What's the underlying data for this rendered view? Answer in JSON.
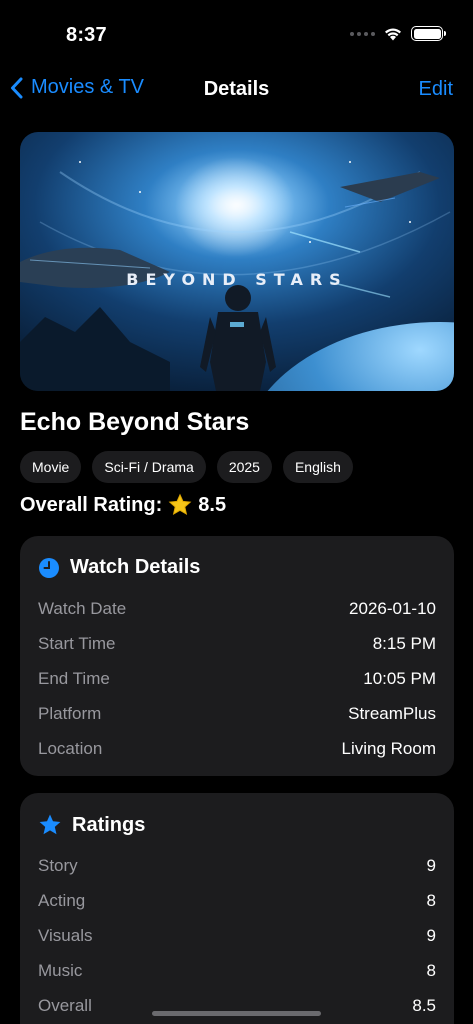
{
  "status_bar": {
    "time": "8:37"
  },
  "nav": {
    "back_label": "Movies & TV",
    "title": "Details",
    "edit_label": "Edit"
  },
  "poster": {
    "title_text": "BEYOND STARS"
  },
  "movie": {
    "title": "Echo Beyond Stars",
    "tags": [
      "Movie",
      "Sci-Fi / Drama",
      "2025",
      "English"
    ],
    "overall_label": "Overall Rating:",
    "overall_value": "8.5"
  },
  "watch_details": {
    "heading": "Watch Details",
    "icon": "clock-icon",
    "rows": [
      {
        "label": "Watch Date",
        "value": "2026-01-10"
      },
      {
        "label": "Start Time",
        "value": "8:15 PM"
      },
      {
        "label": "End Time",
        "value": "10:05 PM"
      },
      {
        "label": "Platform",
        "value": "StreamPlus"
      },
      {
        "label": "Location",
        "value": "Living Room"
      }
    ]
  },
  "ratings": {
    "heading": "Ratings",
    "icon": "star-icon",
    "rows": [
      {
        "label": "Story",
        "value": "9"
      },
      {
        "label": "Acting",
        "value": "8"
      },
      {
        "label": "Visuals",
        "value": "9"
      },
      {
        "label": "Music",
        "value": "8"
      },
      {
        "label": "Overall",
        "value": "8.5"
      }
    ]
  },
  "colors": {
    "accent": "#1a8cff",
    "card_bg": "#1c1c1e",
    "secondary_text": "#98989e",
    "star": "#f5c518"
  }
}
